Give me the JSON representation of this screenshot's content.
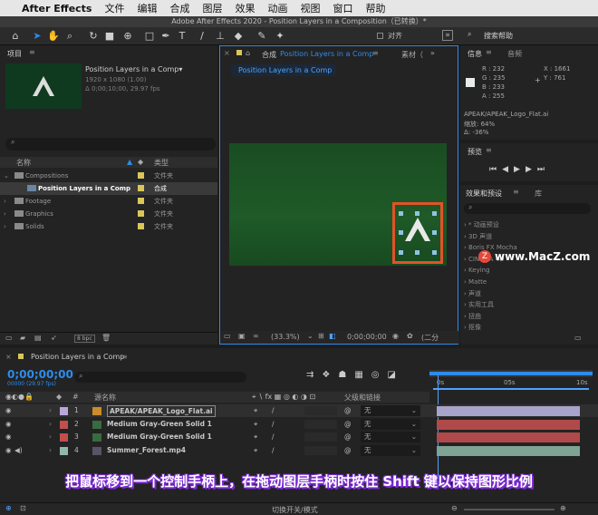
{
  "mac_menu": {
    "app": "After Effects",
    "items": [
      "文件",
      "编辑",
      "合成",
      "图层",
      "效果",
      "动画",
      "视图",
      "窗口",
      "帮助"
    ]
  },
  "window_title": "Adobe After Effects 2020 - Position Layers in a Composition（已转换）*",
  "toolbar": {
    "align_label": "对齐",
    "search_placeholder": "搜索帮助",
    "icons": [
      "home-icon",
      "selection-arrow-icon",
      "hand-icon",
      "zoom-icon",
      "rotate-icon",
      "camera-icon",
      "pan-behind-icon",
      "rectangle-icon",
      "pen-icon",
      "type-icon",
      "brush-icon",
      "clone-stamp-icon",
      "eraser-icon",
      "roto-brush-icon",
      "puppet-pin-icon"
    ]
  },
  "project": {
    "title": "项目",
    "comp_name": "Position Layers in a Comp▾",
    "comp_size": "1920 x 1080 (1.00)",
    "comp_duration": "Δ 0;00;10;00, 29.97 fps",
    "col_name": "名称",
    "col_type": "类型",
    "bpc": "8 bpc",
    "rows": [
      {
        "name": "Compositions",
        "type": "文件夹",
        "color": "#d9c65a"
      },
      {
        "name": "Position Layers in a Comp",
        "type": "合成",
        "color": "#d9c65a"
      },
      {
        "name": "Footage",
        "type": "文件夹",
        "color": "#d9c65a"
      },
      {
        "name": "Graphics",
        "type": "文件夹",
        "color": "#d9c65a"
      },
      {
        "name": "Solids",
        "type": "文件夹",
        "color": "#d9c65a"
      }
    ]
  },
  "comp_panel": {
    "tab_prefix": "合成",
    "tab": "Position Layers in a Comp",
    "footage_tab": "素材（",
    "breadcrumb": "Position Layers in a Comp",
    "zoom": "(33.3%)",
    "timecode": "0;00;00;00",
    "quality": "(二分"
  },
  "info": {
    "tab1": "信息",
    "tab2": "音频",
    "r": "R : 232",
    "g": "G : 235",
    "b": "B : 233",
    "a": "A : 255",
    "x": "X : 1661",
    "y": "Y : 761",
    "file": "APEAK/APEAK_Logo_Flat.ai",
    "scale": "缩放: 64%",
    "delta": "Δ: -36%"
  },
  "preview": {
    "title": "预览"
  },
  "effects": {
    "tab1": "效果和预设",
    "tab2": "库",
    "items": [
      "* 动画预设",
      "3D 声道",
      "Boris FX Mocha",
      "CINEMA 4D",
      "Keying",
      "Matte",
      "声道",
      "实用工具",
      "扭曲",
      "抠像"
    ]
  },
  "watermark": "www.MacZ.com",
  "timeline": {
    "tab": "Position Layers in a Comp",
    "timecode": "0;00;00;00",
    "fps": "00000 (29.97 fps)",
    "col_source": "源名称",
    "col_parent": "父级和链接",
    "ruler": [
      "0s",
      "05s",
      "10s"
    ],
    "layers": [
      {
        "num": "1",
        "name": "APEAK/APEAK_Logo_Flat.ai",
        "color": "#b9a7d8",
        "parent": "无",
        "bar": "#a8a3c8"
      },
      {
        "num": "2",
        "name": "Medium Gray-Green Solid 1",
        "color": "#c0504d",
        "parent": "无",
        "bar": "#b04a4a"
      },
      {
        "num": "3",
        "name": "Medium Gray-Green Solid 1",
        "color": "#c0504d",
        "parent": "无",
        "bar": "#b04a4a"
      },
      {
        "num": "4",
        "name": "Summer_Forest.mp4",
        "color": "#8fb8a8",
        "parent": "无",
        "bar": "#7fa394"
      }
    ],
    "toggle_label": "切换开关/模式"
  },
  "caption": "把鼠标移到一个控制手柄上，在拖动图层手柄时按住 Shift 键以保持图形比例"
}
